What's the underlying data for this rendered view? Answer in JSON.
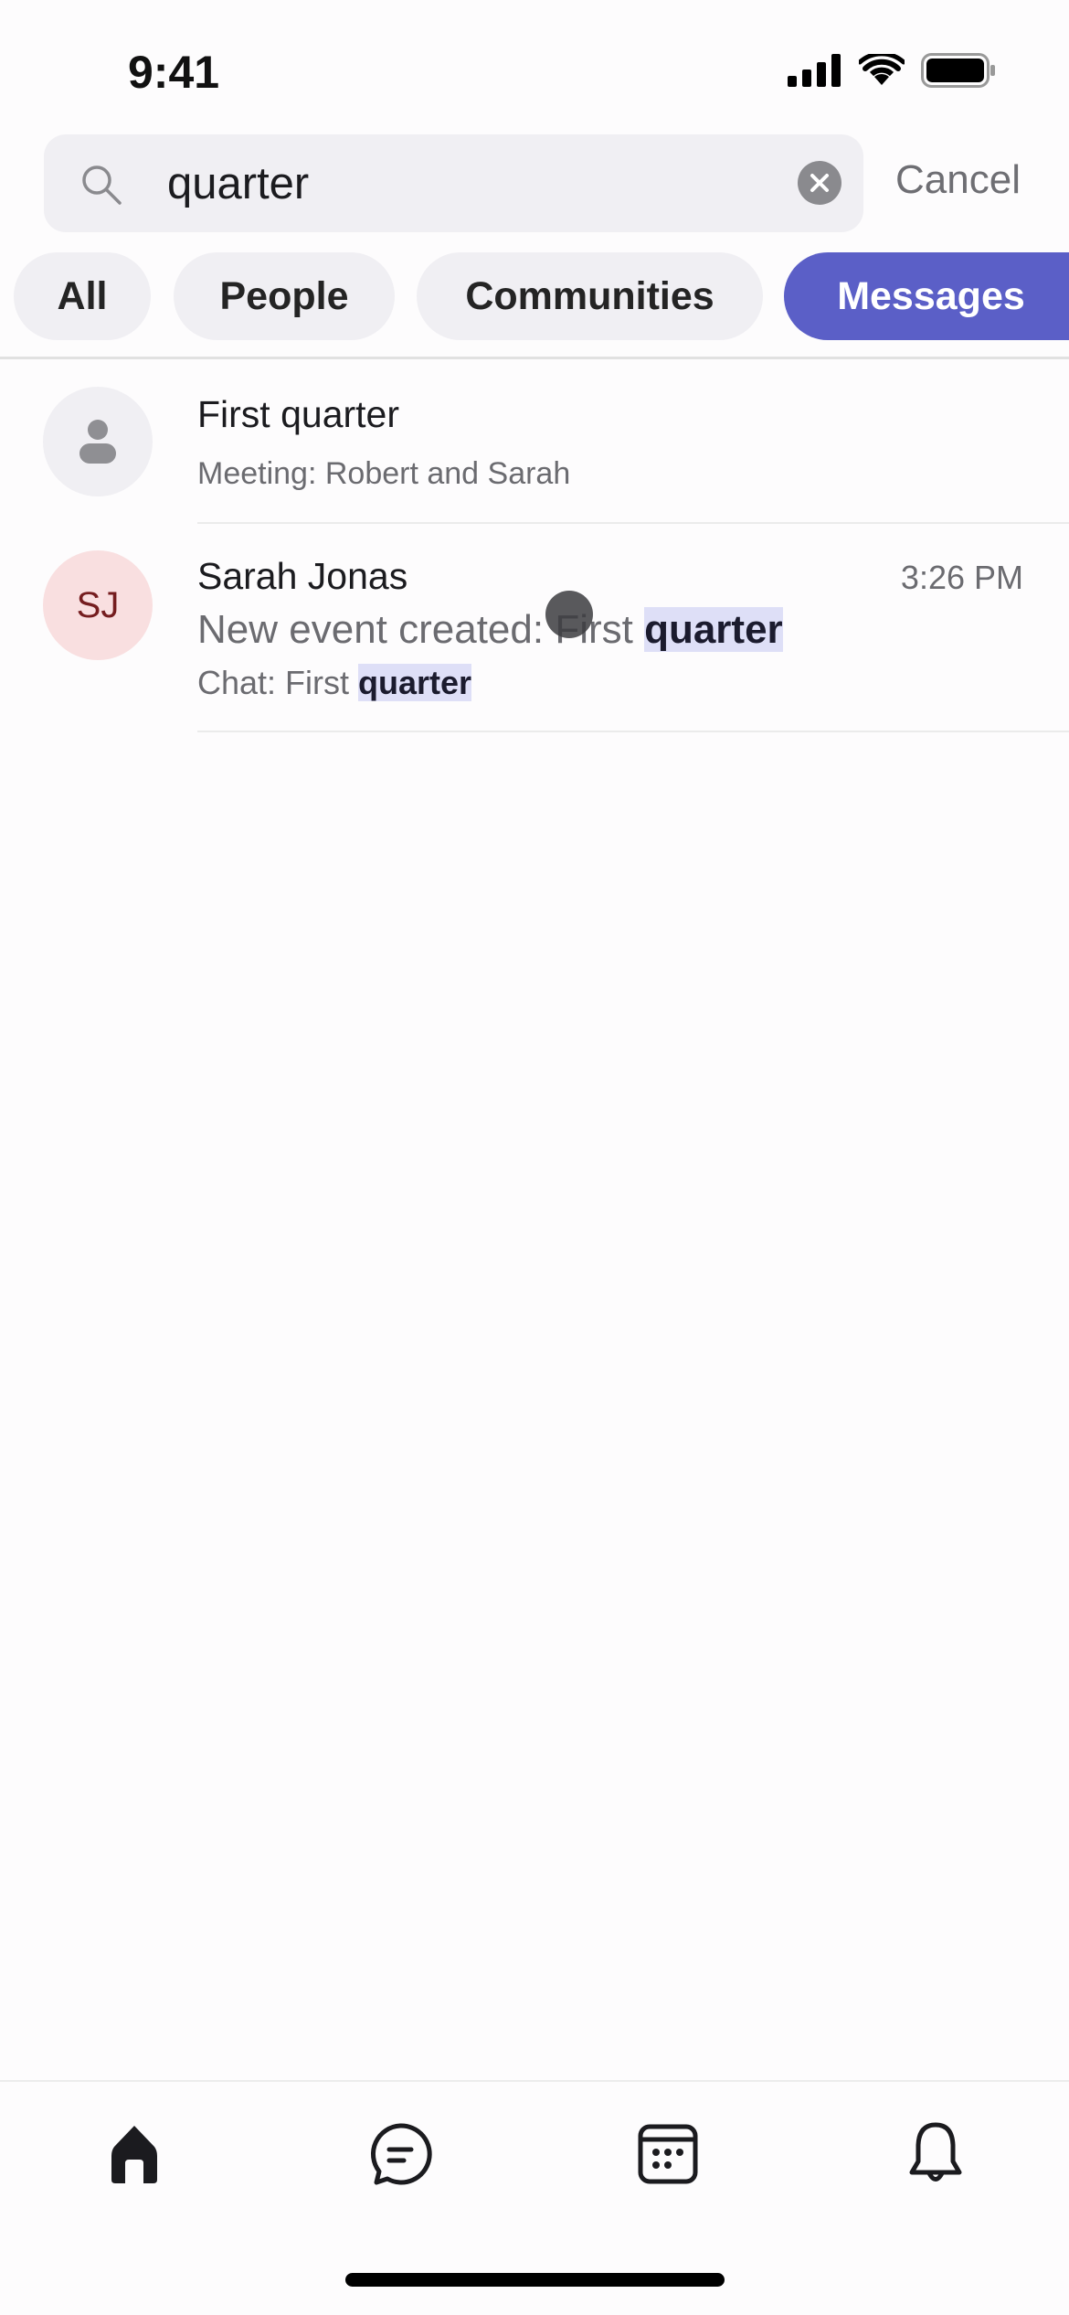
{
  "status_bar": {
    "time": "9:41"
  },
  "search": {
    "value": "quarter",
    "cancel_label": "Cancel"
  },
  "filters": [
    {
      "label": "All",
      "active": false
    },
    {
      "label": "People",
      "active": false
    },
    {
      "label": "Communities",
      "active": false
    },
    {
      "label": "Messages",
      "active": true
    }
  ],
  "results": [
    {
      "title": "First quarter",
      "subtitle": "Meeting: Robert and Sarah",
      "avatar": "person-icon"
    },
    {
      "name": "Sarah Jonas",
      "initials": "SJ",
      "time": "3:26 PM",
      "message_prefix": "New event created: First ",
      "message_match": "quarter",
      "chat_prefix": "Chat: First ",
      "chat_match": "quarter"
    }
  ],
  "tabs": [
    "home-icon",
    "chat-icon",
    "calendar-icon",
    "bell-icon"
  ],
  "colors": {
    "accent": "#5b5fc7",
    "highlight": "#dedff7",
    "sj_avatar_bg": "#f9dfe0",
    "sj_avatar_text": "#751d1f"
  }
}
